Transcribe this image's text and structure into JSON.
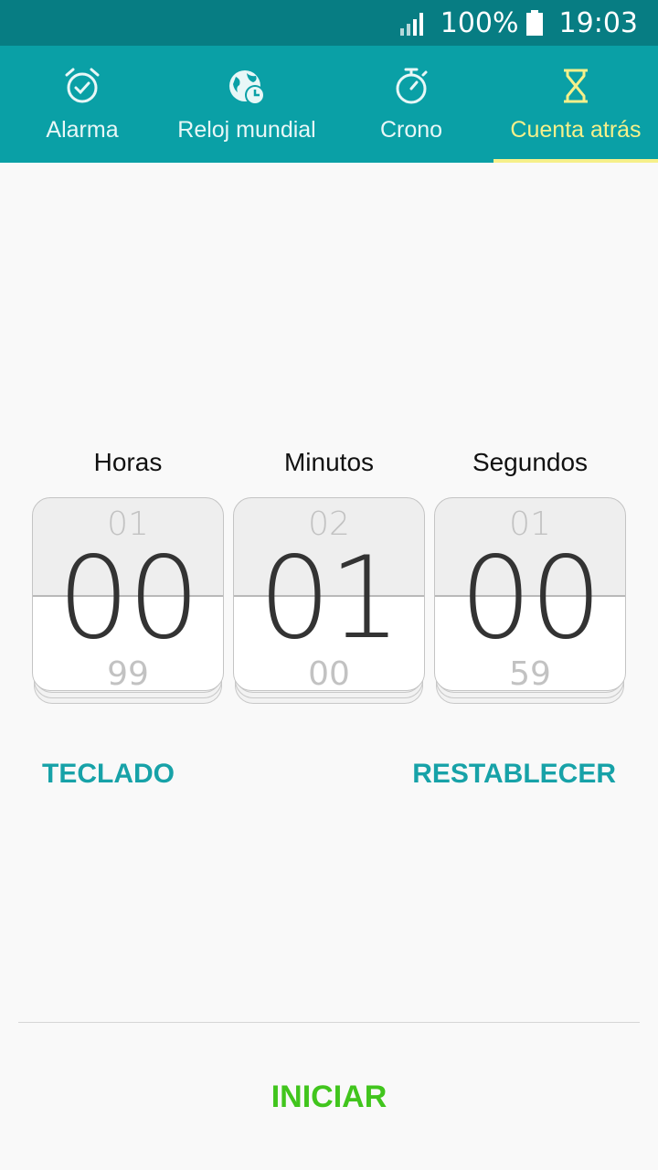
{
  "status_bar": {
    "signal_icon": "signal-icon",
    "battery_percent": "100%",
    "battery_icon": "battery-icon",
    "time": "19:03"
  },
  "tabs": [
    {
      "label": "Alarma",
      "icon": "alarm-clock-icon",
      "active": false
    },
    {
      "label": "Reloj mundial",
      "icon": "world-clock-icon",
      "active": false
    },
    {
      "label": "Crono",
      "icon": "stopwatch-icon",
      "active": false
    },
    {
      "label": "Cuenta atrás",
      "icon": "hourglass-icon",
      "active": true
    }
  ],
  "timer": {
    "hours": {
      "label": "Horas",
      "prev": "01",
      "value": "00",
      "next": "99"
    },
    "minutes": {
      "label": "Minutos",
      "prev": "02",
      "value": "01",
      "next": "00"
    },
    "seconds": {
      "label": "Segundos",
      "prev": "01",
      "value": "00",
      "next": "59"
    }
  },
  "actions": {
    "keyboard_label": "TECLADO",
    "reset_label": "RESTABLECER"
  },
  "start_label": "INICIAR",
  "colors": {
    "status_bar": "#077d83",
    "tab_bar": "#0aa0a6",
    "active_tab": "#f6f08a",
    "link": "#17a2a8",
    "start": "#41c51d"
  }
}
